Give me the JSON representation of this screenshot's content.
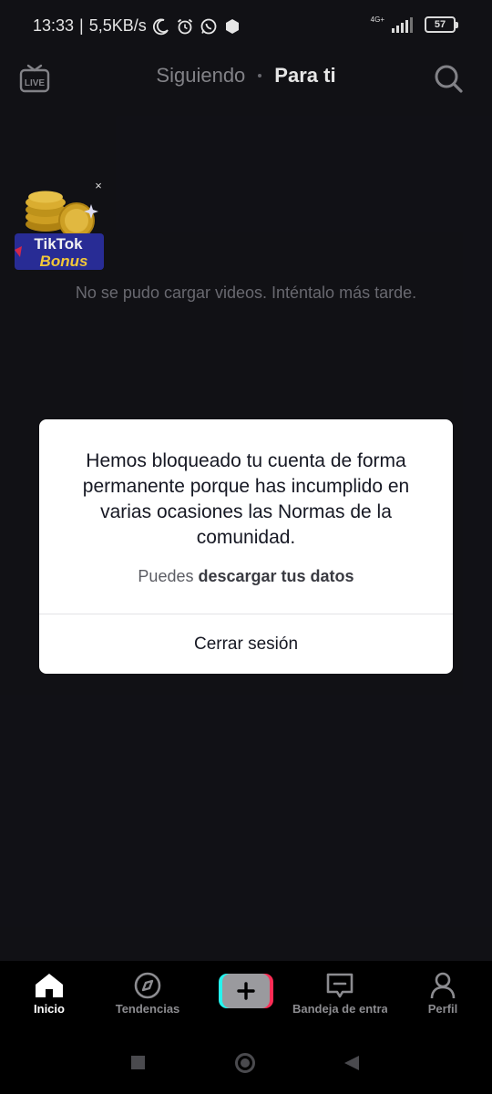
{
  "status_bar": {
    "time": "13:33",
    "separator": "|",
    "data_rate": "5,5KB/s",
    "network": "4G+",
    "battery": "57"
  },
  "top_nav": {
    "live_label": "LIVE",
    "tab_following": "Siguiendo",
    "tab_for_you": "Para ti"
  },
  "bonus": {
    "line1": "TikTok",
    "line2": "Bonus",
    "close": "×"
  },
  "feed": {
    "error_message": "No se pudo cargar videos. Inténtalo más tarde."
  },
  "modal": {
    "message": "Hemos bloqueado tu cuenta de forma permanente porque has incumplido en varias ocasiones las Normas de la comunidad.",
    "download_prefix": "Puedes",
    "download_link": "descargar tus datos",
    "logout_label": "Cerrar sesión"
  },
  "bottom_nav": {
    "home": "Inicio",
    "discover": "Tendencias",
    "inbox": "Bandeja de entrada",
    "profile": "Perfil",
    "create_symbol": "+"
  },
  "colors": {
    "background": "#121217",
    "modal_bg": "#ffffff",
    "create_cyan": "#25f4ee",
    "create_pink": "#fe2c55"
  }
}
